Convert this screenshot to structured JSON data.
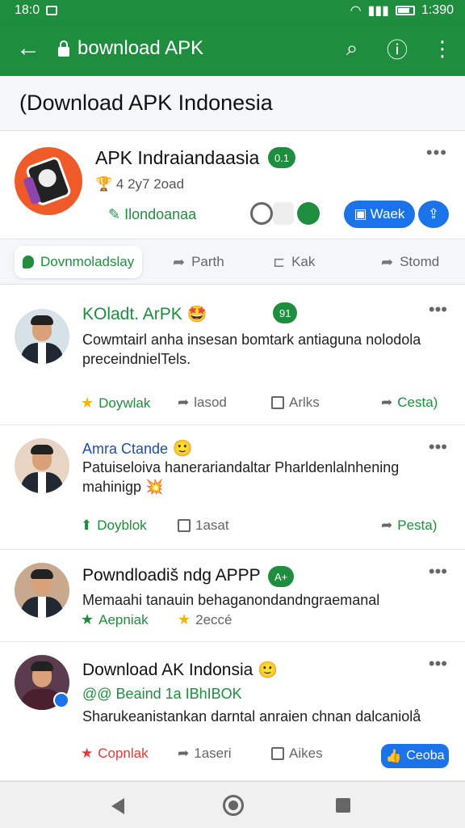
{
  "status_bar": {
    "time": "18:0",
    "right_text": "1:390"
  },
  "app_bar": {
    "back_icon": "arrow-back-icon",
    "title": "bownload APK"
  },
  "page_header": {
    "title": "(Download APK Indonesia"
  },
  "app_card": {
    "name": "APK Indraiandaasia",
    "badge": "0.1",
    "meta": "4  2y7 2oad",
    "link": "Ilondoanaa",
    "primary_button": "Waek"
  },
  "tabs": [
    {
      "label": "Dovnmoladslay"
    },
    {
      "label": "Parth"
    },
    {
      "label": "Kak"
    },
    {
      "label": "Stomd"
    }
  ],
  "posts": [
    {
      "title": "KOladt. ArPK",
      "emoji": "🤩",
      "badge": "91",
      "text": "Cowmtairl anha insesan bomtark antiaguna nolodola\npreceindnielTels.",
      "actions": [
        "Doywlak",
        "lasod",
        "Arlks",
        "Cesta)"
      ]
    },
    {
      "title": "Amra Ctande",
      "emoji": "🙂",
      "text": "Patuiseloiva hanerariandaltar Pharldenlalnhening\nmahinigp 💥",
      "actions": [
        "Doyblok",
        "1asat",
        "Pesta)"
      ]
    },
    {
      "title": "Powndloadiš ndg APPP",
      "badge": "A+",
      "text": "Memaahi tanauin behaganondandngraemanal",
      "actions": [
        "Aepniak",
        "2eccé"
      ]
    },
    {
      "title": "Download AK Indonsia",
      "emoji": "🙂",
      "subtitle": "@@ Beaind 1a IBhIBOK",
      "text": "Sharukeanistankan darntal anraien chnan dalcaniolå",
      "actions": [
        "Copnlak",
        "1aseri",
        "Aikes",
        "Ceoba"
      ]
    }
  ]
}
